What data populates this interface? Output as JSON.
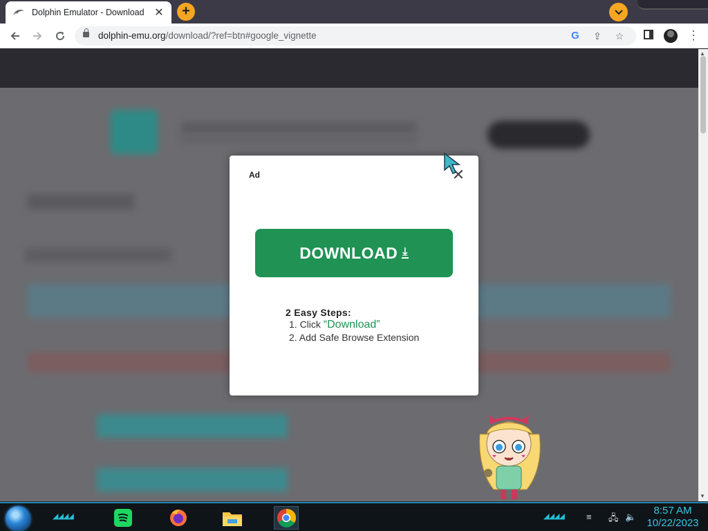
{
  "browser": {
    "tab_title": "Dolphin Emulator - Download",
    "tab_close": "✕",
    "new_tab": "+",
    "url_host": "dolphin-emu.org",
    "url_path": "/download/?ref=btn#google_vignette",
    "back_icon": "arrow-left",
    "forward_icon": "arrow-right",
    "reload_icon": "reload",
    "menu_icon": "kebab"
  },
  "ad": {
    "label": "Ad",
    "close": "✕",
    "download_label": "DOWNLOAD",
    "download_icon": "⤓",
    "steps_title": "2 Easy Steps:",
    "step1_prefix": "1. Click ",
    "step1_highlight": "“Download”",
    "step2": "2. Add Safe Browse Extension",
    "button_color": "#1f9254"
  },
  "taskbar": {
    "time": "8:57 AM",
    "date": "10/22/2023",
    "apps": [
      "spotify",
      "firefox",
      "file-explorer",
      "chrome"
    ],
    "accent": "#39c6e6"
  }
}
